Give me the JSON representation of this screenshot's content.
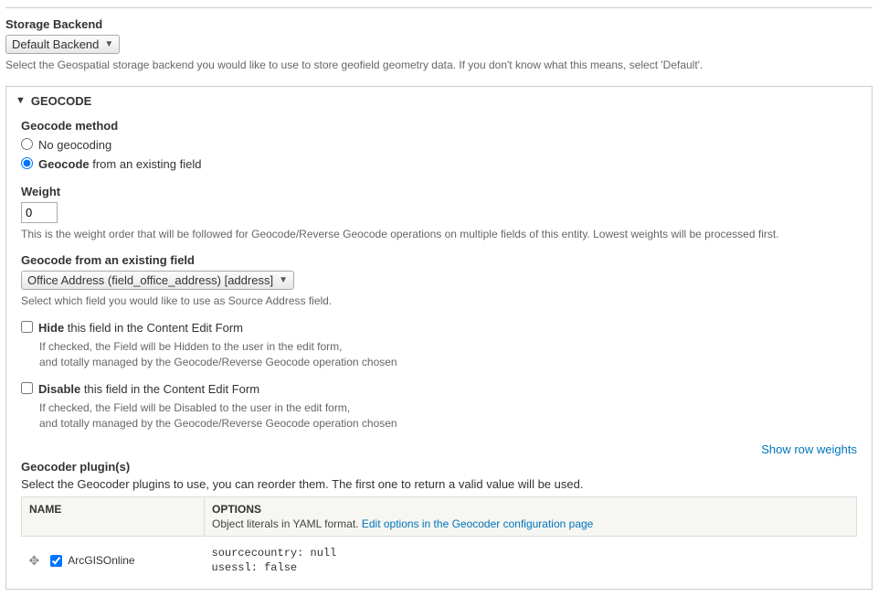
{
  "storage": {
    "label": "Storage Backend",
    "selected": "Default Backend",
    "description": "Select the Geospatial storage backend you would like to use to store geofield geometry data. If you don't know what this means, select 'Default'."
  },
  "geocode": {
    "legend": "GEOCODE",
    "method_label": "Geocode method",
    "method_options": {
      "none_label": "No geocoding",
      "existing_bold": "Geocode",
      "existing_rest": " from an existing field"
    },
    "weight": {
      "label": "Weight",
      "value": "0",
      "description": "This is the weight order that will be followed for Geocode/Reverse Geocode operations on multiple fields of this entity. Lowest weights will be processed first."
    },
    "source": {
      "label": "Geocode from an existing field",
      "selected": "Office Address (field_office_address) [address]",
      "description": "Select which field you would like to use as Source Address field."
    },
    "hide": {
      "bold": "Hide",
      "rest": " this field in the Content Edit Form",
      "desc1": "If checked, the Field will be Hidden to the user in the edit form,",
      "desc2": "and totally managed by the Geocode/Reverse Geocode operation chosen"
    },
    "disable": {
      "bold": "Disable",
      "rest": " this field in the Content Edit Form",
      "desc1": "If checked, the Field will be Disabled to the user in the edit form,",
      "desc2": "and totally managed by the Geocode/Reverse Geocode operation chosen"
    },
    "row_weights_link": "Show row weights",
    "plugins": {
      "label": "Geocoder plugin(s)",
      "description": "Select the Geocoder plugins to use, you can reorder them. The first one to return a valid value will be used.",
      "th_name": "NAME",
      "th_options": "OPTIONS",
      "th_options_sub": "Object literals in YAML format. ",
      "th_options_link": "Edit options in the Geocoder configuration page",
      "rows": [
        {
          "name": "ArcGISOnline",
          "checked": true,
          "options": "sourcecountry: null\nusessl: false"
        }
      ]
    }
  }
}
